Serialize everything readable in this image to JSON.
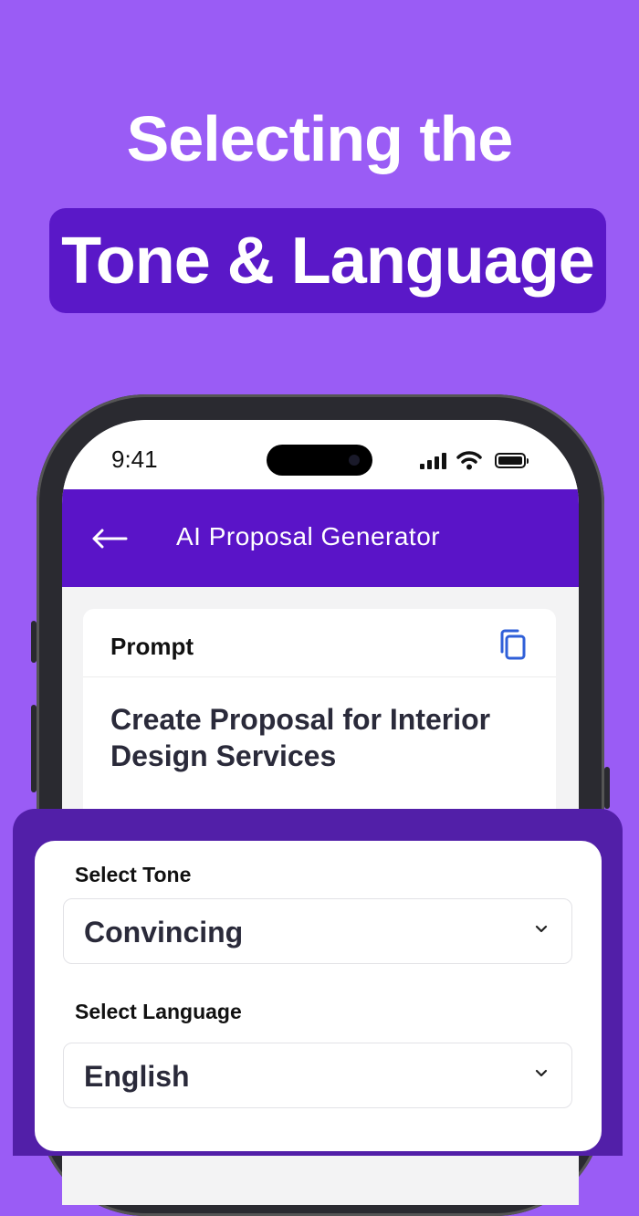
{
  "headline": {
    "line1": "Selecting the",
    "line2": "Tone & Language"
  },
  "phone": {
    "status_bar": {
      "time": "9:41",
      "icons": [
        "cellular-signal-icon",
        "wifi-icon",
        "battery-icon"
      ]
    },
    "app_bar": {
      "back_icon": "arrow-left-icon",
      "title": "AI Proposal Generator"
    },
    "prompt_card": {
      "label": "Prompt",
      "copy_icon": "copy-icon",
      "text": "Create Proposal for Interior Design Services"
    }
  },
  "settings_sheet": {
    "tone": {
      "label": "Select Tone",
      "selected": "Convincing"
    },
    "language": {
      "label": "Select Language",
      "selected": "English"
    }
  },
  "colors": {
    "background": "#9a5cf5",
    "headline_box": "#5a18c8",
    "app_bar": "#5a14c8",
    "sheet": "#521fa8",
    "copy_icon": "#2f5fd8"
  }
}
